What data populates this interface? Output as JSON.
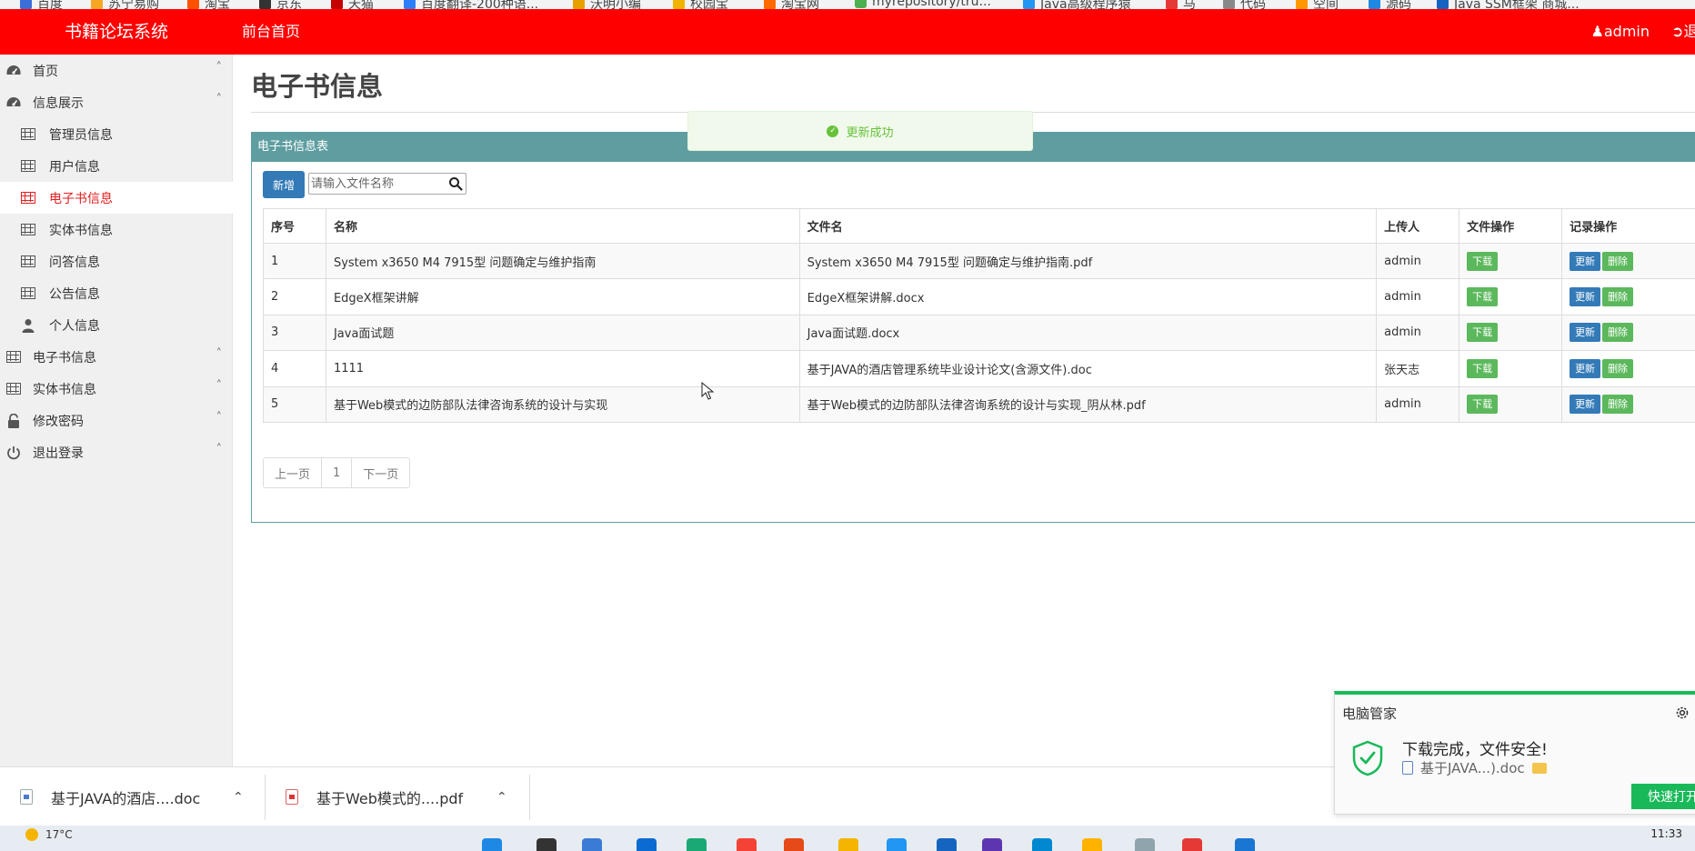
{
  "bookmarks": [
    "百度",
    "苏宁易购",
    "淘宝",
    "京东",
    "天猫",
    "百度翻译-200种语...",
    "沃明小编",
    "校园宝",
    "淘宝网",
    "myrepository/tru...",
    "Java高级程序猿",
    "马",
    "代码",
    "空间",
    "源码",
    "Java SSM框架 商城..."
  ],
  "header": {
    "brand": "书籍论坛系统",
    "home_link": "前台首页",
    "user": "admin",
    "logout": "退出"
  },
  "sidebar": {
    "items": [
      {
        "label": "首页",
        "icon": "dashboard-icon",
        "level": "top",
        "chevron": true
      },
      {
        "label": "信息展示",
        "icon": "dashboard-icon",
        "level": "top",
        "chevron": true
      },
      {
        "label": "管理员信息",
        "icon": "table-icon",
        "level": "sub"
      },
      {
        "label": "用户信息",
        "icon": "table-icon",
        "level": "sub"
      },
      {
        "label": "电子书信息",
        "icon": "table-icon",
        "level": "sub",
        "active": true
      },
      {
        "label": "实体书信息",
        "icon": "table-icon",
        "level": "sub"
      },
      {
        "label": "问答信息",
        "icon": "table-icon",
        "level": "sub"
      },
      {
        "label": "公告信息",
        "icon": "table-icon",
        "level": "sub"
      },
      {
        "label": "个人信息",
        "icon": "user-icon",
        "level": "sub"
      },
      {
        "label": "电子书信息",
        "icon": "table-icon",
        "level": "top",
        "chevron": true
      },
      {
        "label": "实体书信息",
        "icon": "table-icon",
        "level": "top",
        "chevron": true
      },
      {
        "label": "修改密码",
        "icon": "lock-icon",
        "level": "top",
        "chevron": true
      },
      {
        "label": "退出登录",
        "icon": "power-icon",
        "level": "top",
        "chevron": true
      }
    ]
  },
  "main": {
    "title": "电子书信息",
    "panel_title": "电子书信息表",
    "add_button": "新增",
    "search_placeholder": "请输入文件名称",
    "columns": [
      "序号",
      "名称",
      "文件名",
      "上传人",
      "文件操作",
      "记录操作"
    ],
    "rows": [
      {
        "no": "1",
        "name": "System x3650 M4 7915型 问题确定与维护指南",
        "file": "System x3650 M4 7915型 问题确定与维护指南.pdf",
        "uploader": "admin"
      },
      {
        "no": "2",
        "name": "EdgeX框架讲解",
        "file": "EdgeX框架讲解.docx",
        "uploader": "admin"
      },
      {
        "no": "3",
        "name": "Java面试题",
        "file": "Java面试题.docx",
        "uploader": "admin"
      },
      {
        "no": "4",
        "name": "1111",
        "file": "基于JAVA的酒店管理系统毕业设计论文(含源文件).doc",
        "uploader": "张天志"
      },
      {
        "no": "5",
        "name": "基于Web模式的边防部队法律咨询系统的设计与实现",
        "file": "基于Web模式的边防部队法律咨询系统的设计与实现_阴从林.pdf",
        "uploader": "admin"
      }
    ],
    "download_label": "下载",
    "update_label": "更新",
    "delete_label": "删除",
    "pager": {
      "prev": "上一页",
      "page": "1",
      "next": "下一页"
    }
  },
  "toast": {
    "message": "更新成功"
  },
  "downloads": [
    {
      "name": "基于JAVA的酒店....doc",
      "type": "doc"
    },
    {
      "name": "基于Web模式的....pdf",
      "type": "pdf"
    }
  ],
  "popup": {
    "title": "电脑管家",
    "message": "下载完成，文件安全!",
    "file": "基于JAVA...).doc",
    "open_button": "快速打开"
  },
  "taskbar": {
    "weather": "17°C",
    "clock": "11:33"
  },
  "colors": {
    "header": "#ff0000",
    "panel": "#5f9ea0",
    "active": "#e0201f",
    "primary": "#337ab7",
    "success": "#5cb85c",
    "toast": "#67c23a",
    "popup_accent": "#19b95a"
  }
}
